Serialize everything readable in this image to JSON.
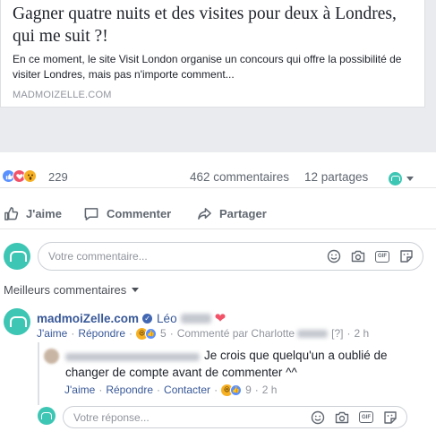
{
  "link_preview": {
    "title": "Gagner quatre nuits et des visites pour deux à Londres, qui me suit ?!",
    "description": "En ce moment, le site Visit London organise un concours qui offre la possibilité de visiter Londres, mais pas n'importe comment...",
    "domain": "MADMOIZELLE.COM"
  },
  "stats": {
    "reaction_count": "229",
    "comments": "462 commentaires",
    "shares": "12 partages"
  },
  "actions": {
    "like": "J'aime",
    "comment": "Commenter",
    "share": "Partager"
  },
  "composer": {
    "placeholder": "Votre commentaire..."
  },
  "filter": {
    "label": "Meilleurs commentaires"
  },
  "comment1": {
    "author": "madmoiZelle.com",
    "tagged": "Léo",
    "like": "J'aime",
    "reply": "Répondre",
    "reaction_count": "5",
    "commented_by": "Commenté par Charlotte",
    "edited": "[?]",
    "time": "2 h"
  },
  "reply1": {
    "text_line1": "Je crois que quelqu'un a oublié de",
    "text_line2": "changer de compte avant de commenter ^^",
    "like": "J'aime",
    "reply": "Répondre",
    "contact": "Contacter",
    "reaction_count": "9",
    "time": "2 h"
  },
  "reply_composer": {
    "placeholder": "Votre réponse..."
  },
  "icons": {
    "gif_label": "GIF"
  },
  "colors": {
    "link": "#385898",
    "brand_avatar": "#3ec6b4",
    "secondary_text": "#90949c"
  }
}
